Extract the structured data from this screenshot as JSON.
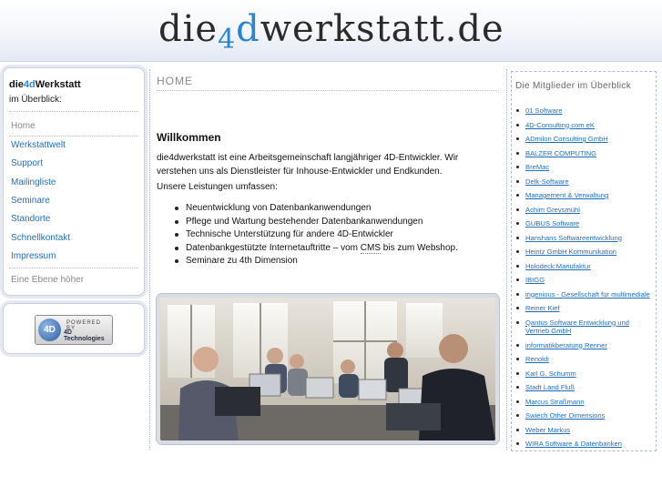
{
  "header": {
    "logo_prefix": "die",
    "logo_four": "4",
    "logo_d": "d",
    "logo_suffix": "werkstatt.de"
  },
  "sidebar": {
    "brand_pre": "die",
    "brand_hl": "4d",
    "brand_post": "Werkstatt",
    "subtitle": "im Überblick:",
    "items": [
      {
        "label": "Home"
      },
      {
        "label": "Werkstattwelt"
      },
      {
        "label": "Support"
      },
      {
        "label": "Mailingliste"
      },
      {
        "label": "Seminare"
      },
      {
        "label": "Standorte"
      },
      {
        "label": "Schnellkontakt"
      },
      {
        "label": "Impressum"
      }
    ],
    "up_label": "Eine Ebene höher"
  },
  "powered": {
    "icon_text": "4D",
    "line1": "POWERED BY",
    "line2": "4D Technologies"
  },
  "main": {
    "breadcrumb": "HOME",
    "title": "Willkommen",
    "intro": "die4dwerkstatt ist eine Arbeitsgemeinschaft langjähriger 4D-Entwickler. Wir verstehen uns als Dienstleister für Inhouse-Entwickler und Endkunden.",
    "services_label": "Unsere Leistungen umfassen:",
    "services": [
      "Neuentwicklung von Datenbankanwendungen",
      "Pflege und Wartung bestehender Datenbankanwendungen",
      "Technische Unterstützung für andere 4D-Entwickler",
      "Seminare zu 4th Dimension"
    ],
    "service_web_pre": "Datenbankgestützte Internetauftritte – vom ",
    "service_web_cms": "CMS",
    "service_web_post": " bis zum Webshop."
  },
  "members": {
    "title": "Die Mitglieder im Überblick",
    "items": [
      "01 Software",
      "4D-Consulting.com eK",
      "ADmilon Consulting GmbH",
      "BALZER COMPUTING",
      "BreMac",
      "Delk-Software",
      "Management & Verwaltung",
      "Achim Grevsmühl",
      "GUBUS Software",
      "Hanshans Softwareentwicklung",
      "Heintz GmbH Kommunikation",
      "Holodeck:Manufaktur",
      "IBIGG",
      "ingenious - Gesellschaft für multimediale",
      "Reiner Kief",
      "Qantus Software Entwicklung und Vertrieb GmbH",
      "informatikberatung Renner",
      "Renoldi",
      "Karl G. Schumm",
      "Stadt Land Fluß",
      "Marcus Straßmann",
      "Swiech Other Dimensions",
      "Weber Markus",
      "WIRA Software & Datenbanken"
    ]
  },
  "colors": {
    "link": "#1f6fc0",
    "accent": "#2a86d3",
    "muted": "#888888"
  }
}
